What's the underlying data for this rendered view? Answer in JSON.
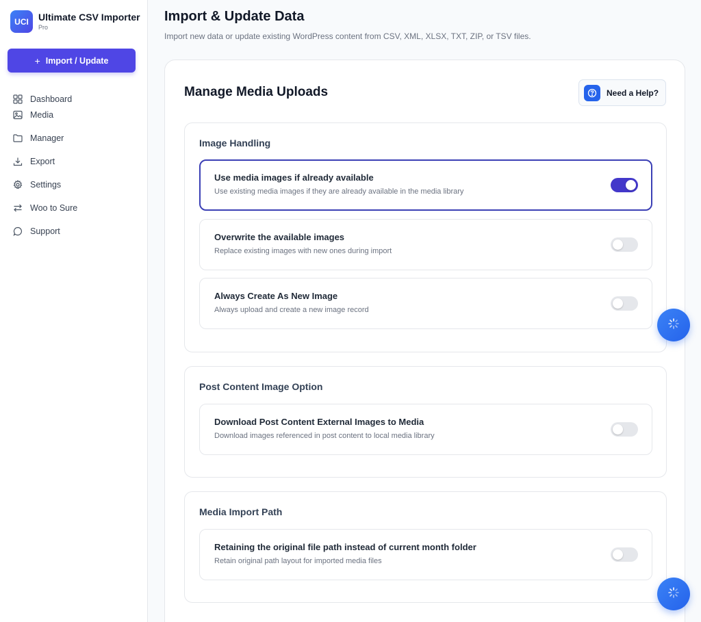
{
  "brand": {
    "logo": "UCI",
    "name": "Ultimate CSV Importer",
    "edition": "Pro"
  },
  "sidebar": {
    "primary_button": "Import / Update",
    "items": [
      {
        "label": "Dashboard",
        "icon": "grid-icon"
      },
      {
        "label": "Media",
        "icon": "image-icon"
      },
      {
        "label": "Manager",
        "icon": "folder-icon"
      },
      {
        "label": "Export",
        "icon": "download-icon"
      },
      {
        "label": "Settings",
        "icon": "gear-icon"
      },
      {
        "label": "Woo to Sure",
        "icon": "swap-icon"
      },
      {
        "label": "Support",
        "icon": "chat-icon"
      }
    ]
  },
  "page": {
    "title": "Import & Update Data",
    "subtitle": "Import new data or update existing WordPress content from CSV, XML, XLSX, TXT, ZIP, or TSV files."
  },
  "card": {
    "title": "Manage Media Uploads",
    "help_label": "Need a Help?"
  },
  "sections": [
    {
      "title": "Image Handling",
      "options": [
        {
          "title": "Use media images if already available",
          "desc": "Use existing media images if they are already available in the media library",
          "enabled": true
        },
        {
          "title": "Overwrite the available images",
          "desc": "Replace existing images with new ones during import",
          "enabled": false
        },
        {
          "title": "Always Create As New Image",
          "desc": "Always upload and create a new image record",
          "enabled": false
        }
      ]
    },
    {
      "title": "Post Content Image Option",
      "options": [
        {
          "title": "Download Post Content External Images to Media",
          "desc": "Download images referenced in post content to local media library",
          "enabled": false
        }
      ]
    },
    {
      "title": "Media Import Path",
      "options": [
        {
          "title": "Retaining the original file path instead of current month folder",
          "desc": "Retain original path layout for imported media files",
          "enabled": false
        }
      ]
    }
  ],
  "colors": {
    "primary": "#4f46e5",
    "toggle_on": "#4338ca",
    "fab": "#2563eb"
  }
}
